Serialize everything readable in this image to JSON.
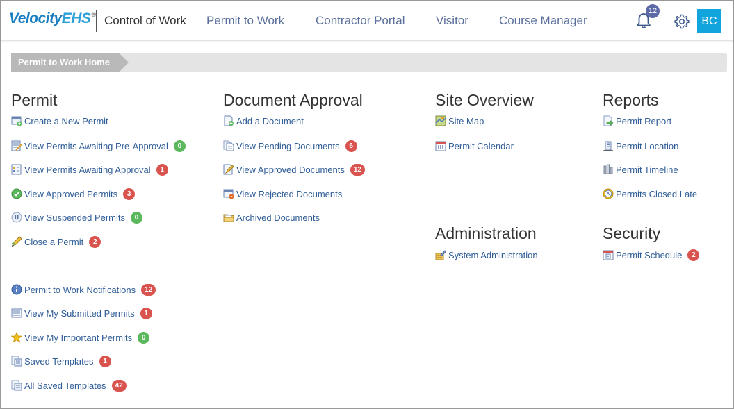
{
  "header": {
    "logo_main": "Velocity",
    "logo_accent": "EHS",
    "logo_tm": "®",
    "app_title": "Control of Work",
    "nav": [
      "Permit to Work",
      "Contractor Portal",
      "Visitor",
      "Course Manager"
    ],
    "notifications_count": "12",
    "avatar_initials": "BC"
  },
  "colors": {
    "nav": "#5a6f9b",
    "link": "#2e5c96",
    "badge_red": "#d9534f",
    "badge_green": "#5cb85c",
    "avatar": "#12a5dd"
  },
  "breadcrumb": "Permit to Work Home",
  "permit": {
    "title": "Permit",
    "items": [
      {
        "label": "Create a New Permit",
        "icon": "new-permit-icon"
      },
      {
        "label": "View Permits Awaiting Pre-Approval",
        "badge": "0",
        "icon": "pre-approval-icon"
      },
      {
        "label": "View Permits Awaiting Approval",
        "badge": "1",
        "icon": "awaiting-approval-icon"
      },
      {
        "label": "View Approved Permits",
        "badge": "3",
        "icon": "check-circle-icon"
      },
      {
        "label": "View Suspended Permits",
        "badge": "0",
        "icon": "pause-circle-icon"
      },
      {
        "label": "Close a Permit",
        "badge": "2",
        "icon": "pencil-icon"
      }
    ],
    "extra": [
      {
        "label": "Permit to Work Notifications",
        "badge": "12",
        "icon": "info-icon"
      },
      {
        "label": "View My Submitted Permits",
        "badge": "1",
        "icon": "list-icon"
      },
      {
        "label": "View My Important Permits",
        "badge": "0",
        "icon": "star-icon"
      },
      {
        "label": "Saved Templates",
        "badge": "1",
        "icon": "template-icon"
      },
      {
        "label": "All Saved Templates",
        "badge": "42",
        "icon": "template-icon"
      }
    ]
  },
  "documents": {
    "title": "Document Approval",
    "items": [
      {
        "label": "Add a Document",
        "icon": "add-document-icon"
      },
      {
        "label": "View Pending Documents",
        "badge": "6",
        "icon": "pending-document-icon"
      },
      {
        "label": "View Approved Documents",
        "badge": "12",
        "icon": "approved-document-icon"
      },
      {
        "label": "View Rejected Documents",
        "icon": "rejected-document-icon"
      },
      {
        "label": "Archived Documents",
        "icon": "folder-icon"
      }
    ]
  },
  "site": {
    "title": "Site Overview",
    "items": [
      {
        "label": "Site Map",
        "icon": "map-icon"
      },
      {
        "label": "Permit Calendar",
        "icon": "calendar-icon"
      }
    ]
  },
  "reports": {
    "title": "Reports",
    "items": [
      {
        "label": "Permit Report",
        "icon": "report-icon"
      },
      {
        "label": "Permit Location",
        "icon": "location-icon"
      },
      {
        "label": "Permit Timeline",
        "icon": "timeline-icon"
      },
      {
        "label": "Permits Closed Late",
        "icon": "clock-icon"
      }
    ]
  },
  "administration": {
    "title": "Administration",
    "items": [
      {
        "label": "System Administration",
        "icon": "admin-icon"
      }
    ]
  },
  "security": {
    "title": "Security",
    "items": [
      {
        "label": "Permit Schedule",
        "badge": "2",
        "icon": "schedule-icon"
      }
    ]
  }
}
